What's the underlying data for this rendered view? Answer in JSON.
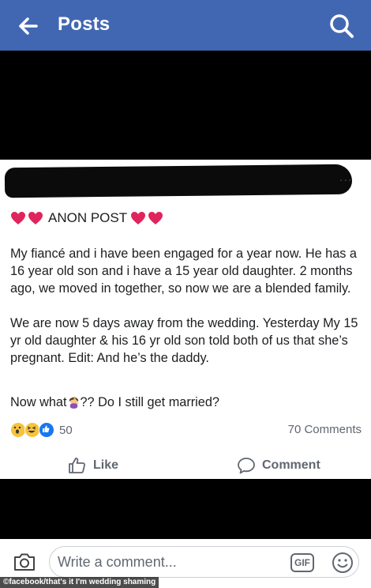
{
  "topbar": {
    "title": "Posts",
    "back_icon": "arrow-left-icon",
    "search_icon": "search-icon"
  },
  "post": {
    "header": "ANON POST",
    "paragraph1": "My fiancé and i have been engaged for a year now. He has a 16 year old son and i have a 15 year old daughter. 2 months ago,  we moved in together,  so now we are a blended family.",
    "paragraph2": "We are now 5 days away from the wedding. Yesterday My 15 yr old daughter & his 16 yr old son told both of us that she’s pregnant. Edit: And he’s the daddy.",
    "paragraph3_before": "Now what",
    "paragraph3_after": "?? Do I still get married?",
    "reaction_count": "50",
    "comments_count": "70 Comments",
    "like_label": "Like",
    "comment_label": "Comment",
    "more_label": "..."
  },
  "composer": {
    "placeholder": "Write a comment...",
    "gif_label": "GIF"
  },
  "watermark": "©facebook/that's it I'm wedding shaming",
  "colors": {
    "brand": "#4267b2",
    "heart": "#e0245e",
    "like_blue": "#1877f2"
  }
}
